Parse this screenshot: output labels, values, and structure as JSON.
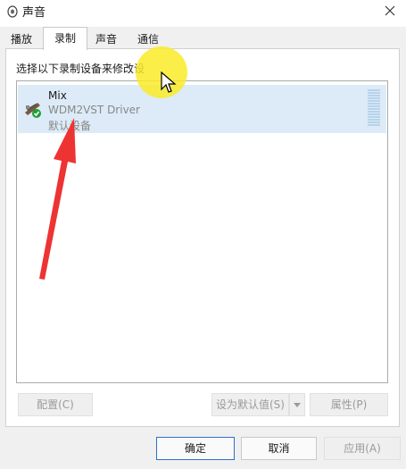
{
  "window": {
    "title": "声音",
    "close_icon": "close-icon"
  },
  "tabs": [
    {
      "label": "播放",
      "active": false
    },
    {
      "label": "录制",
      "active": true
    },
    {
      "label": "声音",
      "active": false
    },
    {
      "label": "通信",
      "active": false
    }
  ],
  "recording": {
    "instruction": "选择以下录制设备来修改设",
    "devices": [
      {
        "name": "Mix",
        "driver": "WDM2VST Driver",
        "status": "默认设备",
        "icon": "mixer-device-icon",
        "badge_icon": "check-badge-icon"
      }
    ]
  },
  "panel_buttons": {
    "configure": "配置(C)",
    "set_default": "设为默认值(S)",
    "properties": "属性(P)"
  },
  "dialog_buttons": {
    "ok": "确定",
    "cancel": "取消",
    "apply": "应用(A)"
  },
  "colors": {
    "accent": "#2f6fca",
    "selection": "#dcebf7",
    "cursor_highlight": "#faeb28",
    "annotation_arrow": "#ee3333",
    "check_badge": "#1f9d3a"
  }
}
